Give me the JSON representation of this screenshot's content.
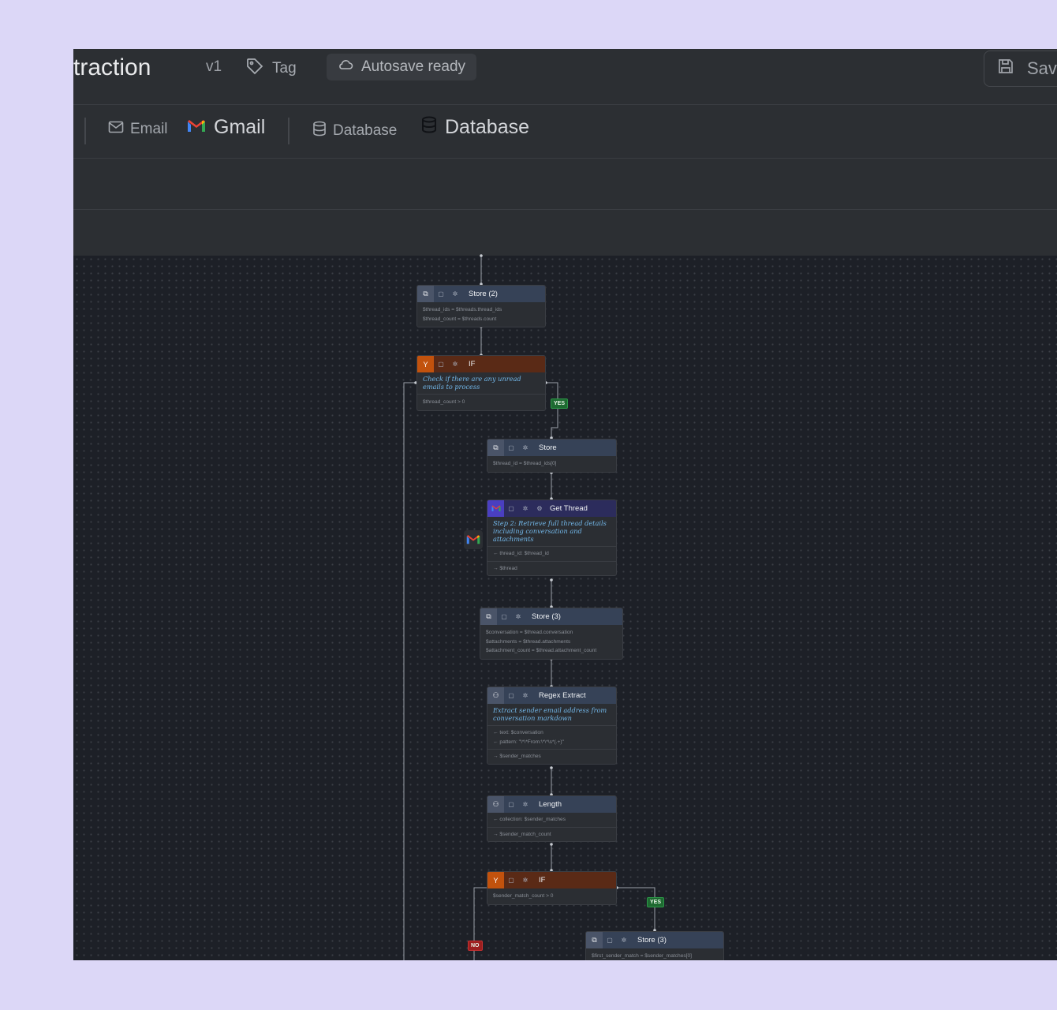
{
  "header": {
    "title": "traction",
    "version": "v1",
    "tag_label": "Tag",
    "autosave_label": "Autosave ready",
    "save_label": "Sav"
  },
  "nodebar": {
    "email_label": "Email",
    "gmail_label": "Gmail",
    "database_small_label": "Database",
    "database_big_label": "Database"
  },
  "nodes": {
    "store2": {
      "title": "Store (2)",
      "lines": [
        "$thread_ids = $threads.thread_ids",
        "$thread_count = $threads.count"
      ]
    },
    "if1": {
      "title": "IF",
      "desc": "Check if there are any unread emails to process",
      "lines": [
        "$thread_count > 0"
      ]
    },
    "store": {
      "title": "Store",
      "lines": [
        "$thread_id = $thread_ids[0]"
      ]
    },
    "getthread": {
      "title": "Get Thread",
      "desc": "Step 2: Retrieve full thread details including conversation and attachments",
      "input": "← thread_id: $thread_id",
      "output": "→ $thread"
    },
    "store3": {
      "title": "Store (3)",
      "lines": [
        "$conversation = $thread.conversation",
        "$attachments = $thread.attachments",
        "$attachment_count = $thread.attachment_count"
      ]
    },
    "regex": {
      "title": "Regex Extract",
      "desc": "Extract sender email address from conversation markdown",
      "inputs": [
        "← text: $conversation",
        "← pattern: \"\\*\\*From:\\*\\*\\s*(.+)\""
      ],
      "output": "→ $sender_matches"
    },
    "length": {
      "title": "Length",
      "input": "← collection: $sender_matches",
      "output": "→ $sender_match_count"
    },
    "if2": {
      "title": "IF",
      "lines": [
        "$sender_match_count > 0"
      ]
    },
    "store3b": {
      "title": "Store (3)",
      "lines": [
        "$first_sender_match = $sender_matches[0]"
      ]
    }
  },
  "badges": {
    "yes": "YES",
    "no": "NO"
  },
  "colors": {
    "accent_orange": "#c2520d",
    "accent_purple": "#4a3fc0",
    "yes_green": "#1e6a31",
    "no_red": "#9c1f1f",
    "desc_blue": "#73b8ea"
  },
  "icons": [
    "tag-icon",
    "cloud-icon",
    "save-icon",
    "mail-icon",
    "gmail-icon",
    "database-icon",
    "store-icon",
    "branch-icon",
    "copy-icon",
    "bug-icon",
    "settings-icon",
    "function-icon"
  ]
}
